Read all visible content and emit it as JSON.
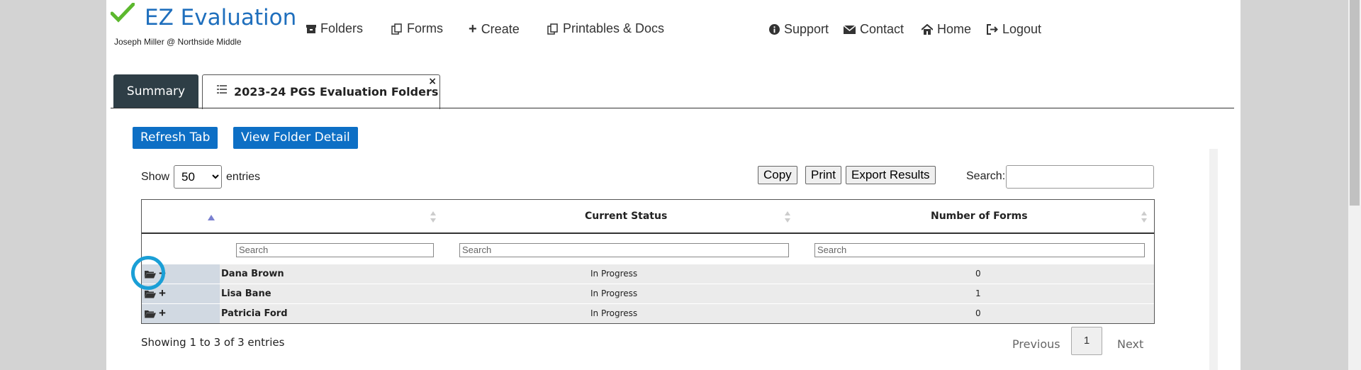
{
  "app": {
    "title": "EZ Evaluation",
    "user": "Joseph Miller @ Northside Middle",
    "brand_color": "#1f6fbd"
  },
  "nav": {
    "folders": "Folders",
    "forms": "Forms",
    "create": "Create",
    "printables": "Printables & Docs",
    "support": "Support",
    "contact": "Contact",
    "home": "Home",
    "logout": "Logout"
  },
  "tabs": {
    "summary": "Summary",
    "active": "2023-24 PGS Evaluation Folders",
    "close": "×"
  },
  "actions": {
    "refresh": "Refresh Tab",
    "view_detail": "View Folder Detail"
  },
  "controls": {
    "show": "Show",
    "entries_value": "50",
    "entries": "entries",
    "copy": "Copy",
    "print": "Print",
    "export": "Export Results",
    "search_label": "Search:"
  },
  "table": {
    "columns": [
      "",
      "",
      "Current Status",
      "Number of Forms"
    ],
    "filter_placeholder": "Search",
    "rows": [
      {
        "name": "Dana Brown",
        "status": "In Progress",
        "forms": "0"
      },
      {
        "name": "Lisa Bane",
        "status": "In Progress",
        "forms": "1"
      },
      {
        "name": "Patricia Ford",
        "status": "In Progress",
        "forms": "0"
      }
    ]
  },
  "footer": {
    "info": "Showing 1 to 3 of 3 entries",
    "previous": "Previous",
    "current_page": "1",
    "next": "Next"
  }
}
